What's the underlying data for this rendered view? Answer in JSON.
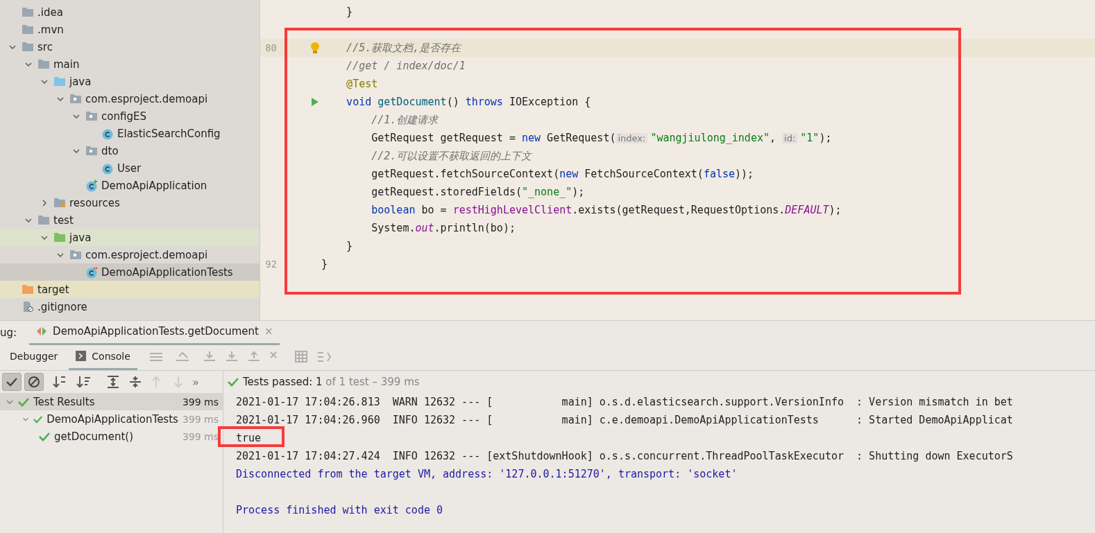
{
  "project_tree": [
    {
      "label": ".idea",
      "kind": "folder"
    },
    {
      "label": ".mvn",
      "kind": "folder"
    },
    {
      "label": "src",
      "kind": "folder",
      "expanded": true,
      "children": [
        {
          "label": "main",
          "kind": "folder",
          "expanded": true,
          "children": [
            {
              "label": "java",
              "kind": "source-root",
              "expanded": true,
              "children": [
                {
                  "label": "com.esproject.demoapi",
                  "kind": "package",
                  "expanded": true,
                  "children": [
                    {
                      "label": "configES",
                      "kind": "package",
                      "expanded": true,
                      "children": [
                        {
                          "label": "ElasticSearchConfig",
                          "kind": "class",
                          "selected": false
                        }
                      ]
                    },
                    {
                      "label": "dto",
                      "kind": "package",
                      "expanded": true,
                      "children": [
                        {
                          "label": "User",
                          "kind": "class",
                          "selected": false
                        }
                      ]
                    },
                    {
                      "label": "DemoApiApplication",
                      "kind": "app-class",
                      "selected": false
                    }
                  ]
                }
              ]
            },
            {
              "label": "resources",
              "kind": "resources",
              "expanded": false
            }
          ]
        },
        {
          "label": "test",
          "kind": "folder",
          "expanded": true,
          "children": [
            {
              "label": "java",
              "kind": "test-root",
              "expanded": true,
              "children": [
                {
                  "label": "com.esproject.demoapi",
                  "kind": "package",
                  "expanded": true,
                  "children": [
                    {
                      "label": "DemoApiApplicationTests",
                      "kind": "test-class",
                      "selected": true
                    }
                  ]
                }
              ]
            }
          ]
        }
      ]
    },
    {
      "label": "target",
      "kind": "excluded"
    },
    {
      "label": ".gitignore",
      "kind": "file"
    }
  ],
  "editor": {
    "lines": [
      {
        "tokens": [
          {
            "text": "    }",
            "kind": "plain"
          }
        ]
      },
      {
        "kind": "blank"
      },
      {
        "number": "80",
        "current": true,
        "tokens": [
          {
            "text": "    //5.获取文档,是否存在",
            "kind": "comment"
          }
        ]
      },
      {
        "tokens": [
          {
            "text": "    //get / index/doc/1",
            "kind": "comment"
          }
        ]
      },
      {
        "tokens": [
          {
            "text": "    @Test",
            "kind": "annotation"
          }
        ]
      },
      {
        "tokens": [
          {
            "text": "    void ",
            "kind": "keyword"
          },
          {
            "text": "getDocument",
            "kind": "method"
          },
          {
            "text": "() ",
            "kind": "plain"
          },
          {
            "text": "throws ",
            "kind": "keyword"
          },
          {
            "text": "IOException {",
            "kind": "plain"
          }
        ]
      },
      {
        "tokens": [
          {
            "text": "        //1.创建请求",
            "kind": "comment"
          }
        ]
      },
      {
        "tokens": [
          {
            "text": "        GetRequest getRequest = ",
            "kind": "plain"
          },
          {
            "text": "new ",
            "kind": "keyword"
          },
          {
            "text": "GetRequest(",
            "kind": "plain"
          },
          {
            "text": "index:",
            "kind": "hint"
          },
          {
            "text": "\"wangjiulong_index\"",
            "kind": "string"
          },
          {
            "text": ", ",
            "kind": "plain"
          },
          {
            "text": "id:",
            "kind": "hint"
          },
          {
            "text": "\"1\"",
            "kind": "string"
          },
          {
            "text": ");",
            "kind": "plain"
          }
        ]
      },
      {
        "tokens": [
          {
            "text": "        //2.可以设置不获取返回的上下文",
            "kind": "comment"
          }
        ]
      },
      {
        "tokens": [
          {
            "text": "        getRequest.fetchSourceContext(",
            "kind": "plain"
          },
          {
            "text": "new ",
            "kind": "keyword"
          },
          {
            "text": "FetchSourceContext(",
            "kind": "plain"
          },
          {
            "text": "false",
            "kind": "keyword"
          },
          {
            "text": "));",
            "kind": "plain"
          }
        ]
      },
      {
        "tokens": [
          {
            "text": "        getRequest.storedFields(",
            "kind": "plain"
          },
          {
            "text": "\"_none_\"",
            "kind": "string"
          },
          {
            "text": ");",
            "kind": "plain"
          }
        ]
      },
      {
        "tokens": [
          {
            "text": "        boolean ",
            "kind": "keyword"
          },
          {
            "text": "bo = ",
            "kind": "plain"
          },
          {
            "text": "restHighLevelClient",
            "kind": "field"
          },
          {
            "text": ".exists(getRequest,RequestOptions.",
            "kind": "plain"
          },
          {
            "text": "DEFAULT",
            "kind": "static"
          },
          {
            "text": ");",
            "kind": "plain"
          }
        ]
      },
      {
        "tokens": [
          {
            "text": "        System.",
            "kind": "plain"
          },
          {
            "text": "out",
            "kind": "static"
          },
          {
            "text": ".println(bo);",
            "kind": "plain"
          }
        ]
      },
      {
        "tokens": [
          {
            "text": "    }",
            "kind": "plain"
          }
        ]
      },
      {
        "number": "92",
        "tokens": [
          {
            "text": "}",
            "kind": "plain"
          }
        ]
      }
    ]
  },
  "debug": {
    "label": "ug:",
    "tab": "DemoApiApplicationTests.getDocument",
    "close": "×",
    "tabs": [
      {
        "label": "Debugger",
        "selected": false
      },
      {
        "label": "Console",
        "selected": true
      }
    ]
  },
  "test_toolbar": {
    "show_passed": {
      "on": true
    },
    "show_ignored": {
      "on": true
    },
    "more": "»"
  },
  "status": {
    "label": "Tests passed:",
    "count": "1",
    "rest": "of 1 test – 399 ms"
  },
  "test_results": [
    {
      "label": "Test Results",
      "time": "399 ms",
      "passed": true,
      "children": [
        {
          "label": "DemoApiApplicationTests",
          "time": "399 ms",
          "passed": true,
          "children": [
            {
              "label": "getDocument()",
              "time": "399 ms",
              "passed": true
            }
          ]
        }
      ]
    }
  ],
  "console": [
    {
      "text": "2021-01-17 17:04:26.813  WARN 12632 --- [           main] o.s.d.elasticsearch.support.VersionInfo  : Version mismatch in bet",
      "kind": "log"
    },
    {
      "text": "2021-01-17 17:04:26.960  INFO 12632 --- [           main] c.e.demoapi.DemoApiApplicationTests      : Started DemoApiApplicat",
      "kind": "log"
    },
    {
      "text": "true",
      "kind": "log"
    },
    {
      "text": "2021-01-17 17:04:27.424  INFO 12632 --- [extShutdownHook] o.s.s.concurrent.ThreadPoolTaskExecutor  : Shutting down ExecutorS",
      "kind": "log"
    },
    {
      "text": "Disconnected from the target VM, address: '127.0.0.1:51270', transport: 'socket'",
      "kind": "system"
    },
    {
      "kind": "blank"
    },
    {
      "text": "Process finished with exit code 0",
      "kind": "system"
    }
  ]
}
